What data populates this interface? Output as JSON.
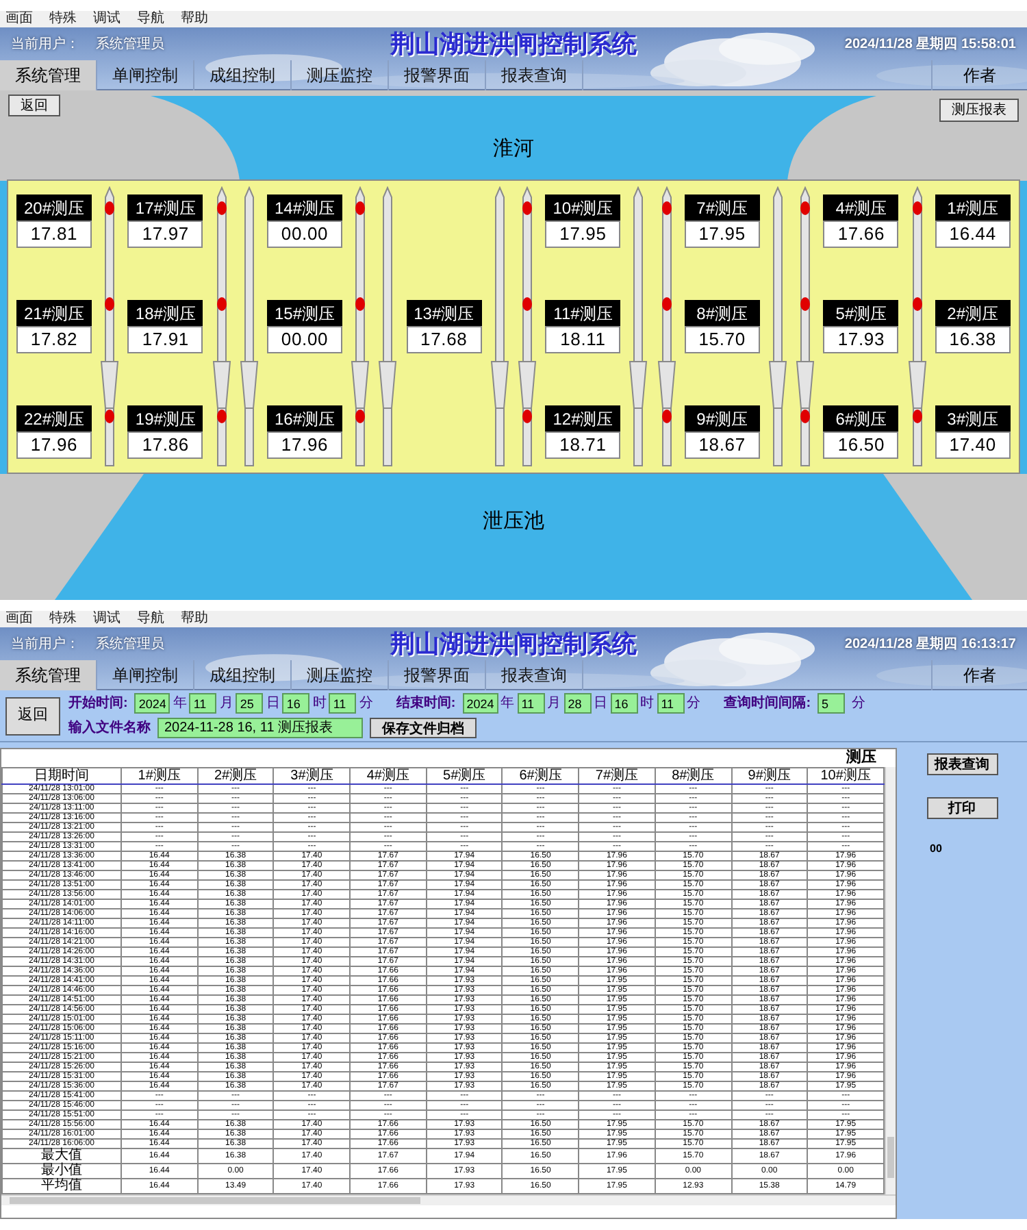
{
  "monitor_screen": {
    "header": {
      "menu": [
        "画面",
        "特殊",
        "调试",
        "导航",
        "帮助"
      ],
      "user_label": "当前用户：",
      "user": "系统管理员",
      "title": "荆山湖进洪闸控制系统",
      "datetime": "2024/11/28 星期四 15:58:01",
      "tabs": [
        {
          "label": "系统管理",
          "selected": true
        },
        {
          "label": "单闸控制",
          "selected": false
        },
        {
          "label": "成组控制",
          "selected": false
        },
        {
          "label": "测压监控",
          "selected": false
        },
        {
          "label": "报警界面",
          "selected": false
        },
        {
          "label": "报表查询",
          "selected": false
        }
      ],
      "author_tab": "作者"
    },
    "back_button": "返回",
    "report_button": "测压报表",
    "river_label": "淮河",
    "pool_label": "泄压池",
    "gauge_panel": {
      "items": [
        {
          "kind": "gauges",
          "gauges": [
            {
              "label": "20#测压",
              "value": "17.81"
            },
            {
              "label": "21#测压",
              "value": "17.82"
            },
            {
              "label": "22#测压",
              "value": "17.96"
            }
          ]
        },
        {
          "kind": "pipe",
          "marked": true
        },
        {
          "kind": "gauges",
          "gauges": [
            {
              "label": "17#测压",
              "value": "17.97"
            },
            {
              "label": "18#测压",
              "value": "17.91"
            },
            {
              "label": "19#测压",
              "value": "17.86"
            }
          ]
        },
        {
          "kind": "pipe",
          "marked": true
        },
        {
          "kind": "pipe",
          "marked": false
        },
        {
          "kind": "gauges",
          "gauges": [
            {
              "label": "14#测压",
              "value": "00.00"
            },
            {
              "label": "15#测压",
              "value": "00.00"
            },
            {
              "label": "16#测压",
              "value": "17.96"
            }
          ]
        },
        {
          "kind": "pipe",
          "marked": true
        },
        {
          "kind": "pipe",
          "marked": false
        },
        {
          "kind": "gauges",
          "gauges": [
            {
              "label": "13#测压",
              "value": "17.68"
            }
          ]
        },
        {
          "kind": "pipe",
          "marked": false
        },
        {
          "kind": "pipe",
          "marked": true
        },
        {
          "kind": "gauges",
          "gauges": [
            {
              "label": "10#测压",
              "value": "17.95"
            },
            {
              "label": "11#测压",
              "value": "18.11"
            },
            {
              "label": "12#测压",
              "value": "18.71"
            }
          ]
        },
        {
          "kind": "pipe",
          "marked": false
        },
        {
          "kind": "pipe",
          "marked": true
        },
        {
          "kind": "gauges",
          "gauges": [
            {
              "label": "7#测压",
              "value": "17.95"
            },
            {
              "label": "8#测压",
              "value": "15.70"
            },
            {
              "label": "9#测压",
              "value": "18.67"
            }
          ]
        },
        {
          "kind": "pipe",
          "marked": false
        },
        {
          "kind": "pipe",
          "marked": true
        },
        {
          "kind": "gauges",
          "gauges": [
            {
              "label": "4#测压",
              "value": "17.66"
            },
            {
              "label": "5#测压",
              "value": "17.93"
            },
            {
              "label": "6#测压",
              "value": "16.50"
            }
          ]
        },
        {
          "kind": "pipe",
          "marked": true
        },
        {
          "kind": "gauges",
          "gauges": [
            {
              "label": "1#测压",
              "value": "16.44"
            },
            {
              "label": "2#测压",
              "value": "16.38"
            },
            {
              "label": "3#测压",
              "value": "17.40"
            }
          ]
        }
      ]
    }
  },
  "report_screen": {
    "header": {
      "menu": [
        "画面",
        "特殊",
        "调试",
        "导航",
        "帮助"
      ],
      "user_label": "当前用户：",
      "user": "系统管理员",
      "title": "荆山湖进洪闸控制系统",
      "datetime": "2024/11/28 星期四 16:13:17",
      "tabs": [
        {
          "label": "系统管理",
          "selected": true
        },
        {
          "label": "单闸控制",
          "selected": false
        },
        {
          "label": "成组控制",
          "selected": false
        },
        {
          "label": "测压监控",
          "selected": false
        },
        {
          "label": "报警界面",
          "selected": false
        },
        {
          "label": "报表查询",
          "selected": false
        }
      ],
      "author_tab": "作者"
    },
    "toolbar": {
      "back_button": "返回",
      "start_label": "开始时间:",
      "start": [
        {
          "value": "2024",
          "unit": "年"
        },
        {
          "value": "11",
          "unit": "月"
        },
        {
          "value": "25",
          "unit": "日"
        },
        {
          "value": "16",
          "unit": "时"
        },
        {
          "value": "11",
          "unit": "分"
        }
      ],
      "end_label": "结束时间:",
      "end": [
        {
          "value": "2024",
          "unit": "年"
        },
        {
          "value": "11",
          "unit": "月"
        },
        {
          "value": "28",
          "unit": "日"
        },
        {
          "value": "16",
          "unit": "时"
        },
        {
          "value": "11",
          "unit": "分"
        }
      ],
      "interval_label": "查询时间间隔:",
      "interval": {
        "value": "5",
        "unit": "分"
      },
      "file_label": "输入文件名称",
      "file_name": "2024-11-28 16, 11 测压报表",
      "save_button": "保存文件归档"
    },
    "table": {
      "title": "测压",
      "columns": [
        "日期时间",
        "1#测压",
        "2#测压",
        "3#测压",
        "4#测压",
        "5#测压",
        "6#测压",
        "7#测压",
        "8#测压",
        "9#测压",
        "10#测压"
      ],
      "rows": [
        [
          "24/11/28 13:01:00",
          "---",
          "---",
          "---",
          "---",
          "---",
          "---",
          "---",
          "---",
          "---",
          "---"
        ],
        [
          "24/11/28 13:06:00",
          "---",
          "---",
          "---",
          "---",
          "---",
          "---",
          "---",
          "---",
          "---",
          "---"
        ],
        [
          "24/11/28 13:11:00",
          "---",
          "---",
          "---",
          "---",
          "---",
          "---",
          "---",
          "---",
          "---",
          "---"
        ],
        [
          "24/11/28 13:16:00",
          "---",
          "---",
          "---",
          "---",
          "---",
          "---",
          "---",
          "---",
          "---",
          "---"
        ],
        [
          "24/11/28 13:21:00",
          "---",
          "---",
          "---",
          "---",
          "---",
          "---",
          "---",
          "---",
          "---",
          "---"
        ],
        [
          "24/11/28 13:26:00",
          "---",
          "---",
          "---",
          "---",
          "---",
          "---",
          "---",
          "---",
          "---",
          "---"
        ],
        [
          "24/11/28 13:31:00",
          "---",
          "---",
          "---",
          "---",
          "---",
          "---",
          "---",
          "---",
          "---",
          "---"
        ],
        [
          "24/11/28 13:36:00",
          "16.44",
          "16.38",
          "17.40",
          "17.67",
          "17.94",
          "16.50",
          "17.96",
          "15.70",
          "18.67",
          "17.96"
        ],
        [
          "24/11/28 13:41:00",
          "16.44",
          "16.38",
          "17.40",
          "17.67",
          "17.94",
          "16.50",
          "17.96",
          "15.70",
          "18.67",
          "17.96"
        ],
        [
          "24/11/28 13:46:00",
          "16.44",
          "16.38",
          "17.40",
          "17.67",
          "17.94",
          "16.50",
          "17.96",
          "15.70",
          "18.67",
          "17.96"
        ],
        [
          "24/11/28 13:51:00",
          "16.44",
          "16.38",
          "17.40",
          "17.67",
          "17.94",
          "16.50",
          "17.96",
          "15.70",
          "18.67",
          "17.96"
        ],
        [
          "24/11/28 13:56:00",
          "16.44",
          "16.38",
          "17.40",
          "17.67",
          "17.94",
          "16.50",
          "17.96",
          "15.70",
          "18.67",
          "17.96"
        ],
        [
          "24/11/28 14:01:00",
          "16.44",
          "16.38",
          "17.40",
          "17.67",
          "17.94",
          "16.50",
          "17.96",
          "15.70",
          "18.67",
          "17.96"
        ],
        [
          "24/11/28 14:06:00",
          "16.44",
          "16.38",
          "17.40",
          "17.67",
          "17.94",
          "16.50",
          "17.96",
          "15.70",
          "18.67",
          "17.96"
        ],
        [
          "24/11/28 14:11:00",
          "16.44",
          "16.38",
          "17.40",
          "17.67",
          "17.94",
          "16.50",
          "17.96",
          "15.70",
          "18.67",
          "17.96"
        ],
        [
          "24/11/28 14:16:00",
          "16.44",
          "16.38",
          "17.40",
          "17.67",
          "17.94",
          "16.50",
          "17.96",
          "15.70",
          "18.67",
          "17.96"
        ],
        [
          "24/11/28 14:21:00",
          "16.44",
          "16.38",
          "17.40",
          "17.67",
          "17.94",
          "16.50",
          "17.96",
          "15.70",
          "18.67",
          "17.96"
        ],
        [
          "24/11/28 14:26:00",
          "16.44",
          "16.38",
          "17.40",
          "17.67",
          "17.94",
          "16.50",
          "17.96",
          "15.70",
          "18.67",
          "17.96"
        ],
        [
          "24/11/28 14:31:00",
          "16.44",
          "16.38",
          "17.40",
          "17.67",
          "17.94",
          "16.50",
          "17.96",
          "15.70",
          "18.67",
          "17.96"
        ],
        [
          "24/11/28 14:36:00",
          "16.44",
          "16.38",
          "17.40",
          "17.66",
          "17.94",
          "16.50",
          "17.96",
          "15.70",
          "18.67",
          "17.96"
        ],
        [
          "24/11/28 14:41:00",
          "16.44",
          "16.38",
          "17.40",
          "17.66",
          "17.93",
          "16.50",
          "17.95",
          "15.70",
          "18.67",
          "17.96"
        ],
        [
          "24/11/28 14:46:00",
          "16.44",
          "16.38",
          "17.40",
          "17.66",
          "17.93",
          "16.50",
          "17.95",
          "15.70",
          "18.67",
          "17.96"
        ],
        [
          "24/11/28 14:51:00",
          "16.44",
          "16.38",
          "17.40",
          "17.66",
          "17.93",
          "16.50",
          "17.95",
          "15.70",
          "18.67",
          "17.96"
        ],
        [
          "24/11/28 14:56:00",
          "16.44",
          "16.38",
          "17.40",
          "17.66",
          "17.93",
          "16.50",
          "17.95",
          "15.70",
          "18.67",
          "17.96"
        ],
        [
          "24/11/28 15:01:00",
          "16.44",
          "16.38",
          "17.40",
          "17.66",
          "17.93",
          "16.50",
          "17.95",
          "15.70",
          "18.67",
          "17.96"
        ],
        [
          "24/11/28 15:06:00",
          "16.44",
          "16.38",
          "17.40",
          "17.66",
          "17.93",
          "16.50",
          "17.95",
          "15.70",
          "18.67",
          "17.96"
        ],
        [
          "24/11/28 15:11:00",
          "16.44",
          "16.38",
          "17.40",
          "17.66",
          "17.93",
          "16.50",
          "17.95",
          "15.70",
          "18.67",
          "17.96"
        ],
        [
          "24/11/28 15:16:00",
          "16.44",
          "16.38",
          "17.40",
          "17.66",
          "17.93",
          "16.50",
          "17.95",
          "15.70",
          "18.67",
          "17.96"
        ],
        [
          "24/11/28 15:21:00",
          "16.44",
          "16.38",
          "17.40",
          "17.66",
          "17.93",
          "16.50",
          "17.95",
          "15.70",
          "18.67",
          "17.96"
        ],
        [
          "24/11/28 15:26:00",
          "16.44",
          "16.38",
          "17.40",
          "17.66",
          "17.93",
          "16.50",
          "17.95",
          "15.70",
          "18.67",
          "17.96"
        ],
        [
          "24/11/28 15:31:00",
          "16.44",
          "16.38",
          "17.40",
          "17.66",
          "17.93",
          "16.50",
          "17.95",
          "15.70",
          "18.67",
          "17.96"
        ],
        [
          "24/11/28 15:36:00",
          "16.44",
          "16.38",
          "17.40",
          "17.67",
          "17.93",
          "16.50",
          "17.95",
          "15.70",
          "18.67",
          "17.95"
        ],
        [
          "24/11/28 15:41:00",
          "---",
          "---",
          "---",
          "---",
          "---",
          "---",
          "---",
          "---",
          "---",
          "---"
        ],
        [
          "24/11/28 15:46:00",
          "---",
          "---",
          "---",
          "---",
          "---",
          "---",
          "---",
          "---",
          "---",
          "---"
        ],
        [
          "24/11/28 15:51:00",
          "---",
          "---",
          "---",
          "---",
          "---",
          "---",
          "---",
          "---",
          "---",
          "---"
        ],
        [
          "24/11/28 15:56:00",
          "16.44",
          "16.38",
          "17.40",
          "17.66",
          "17.93",
          "16.50",
          "17.95",
          "15.70",
          "18.67",
          "17.95"
        ],
        [
          "24/11/28 16:01:00",
          "16.44",
          "16.38",
          "17.40",
          "17.66",
          "17.93",
          "16.50",
          "17.95",
          "15.70",
          "18.67",
          "17.95"
        ],
        [
          "24/11/28 16:06:00",
          "16.44",
          "16.38",
          "17.40",
          "17.66",
          "17.93",
          "16.50",
          "17.95",
          "15.70",
          "18.67",
          "17.95"
        ]
      ],
      "summary_rows": [
        [
          "最大值",
          "16.44",
          "16.38",
          "17.40",
          "17.67",
          "17.94",
          "16.50",
          "17.96",
          "15.70",
          "18.67",
          "17.96"
        ],
        [
          "最小值",
          "16.44",
          "0.00",
          "17.40",
          "17.66",
          "17.93",
          "16.50",
          "17.95",
          "0.00",
          "0.00",
          "0.00"
        ],
        [
          "平均值",
          "16.44",
          "13.49",
          "17.40",
          "17.66",
          "17.93",
          "16.50",
          "17.95",
          "12.93",
          "15.38",
          "14.79"
        ]
      ]
    },
    "side_panel": {
      "query_button": "报表查询",
      "print_button": "打印",
      "note": "00"
    }
  }
}
